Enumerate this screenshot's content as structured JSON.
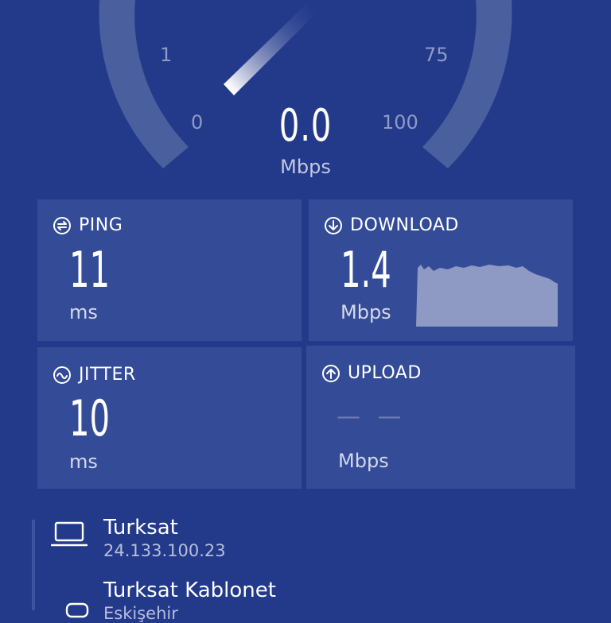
{
  "gauge": {
    "ticks": {
      "t0": "0",
      "t1": "1",
      "t75": "75",
      "t100": "100"
    },
    "value": "0.0",
    "unit": "Mbps"
  },
  "cards": {
    "ping": {
      "label": "PING",
      "value": "11",
      "unit": "ms",
      "icon": "ping-icon"
    },
    "download": {
      "label": "DOWNLOAD",
      "value": "1.4",
      "unit": "Mbps",
      "icon": "download-arrow-icon"
    },
    "jitter": {
      "label": "JITTER",
      "value": "10",
      "unit": "ms",
      "icon": "jitter-wave-icon"
    },
    "upload": {
      "label": "UPLOAD",
      "value": "— —",
      "unit": "Mbps",
      "icon": "upload-arrow-icon"
    }
  },
  "connection": {
    "provider": "Turksat",
    "ip": "24.133.100.23",
    "server_name": "Turksat Kablonet",
    "server_location": "Eskişehir"
  },
  "colors": {
    "background": "#233a8b",
    "card": "#344c97",
    "arc": "#4a5f9e",
    "graph_fill": "#8e99c4"
  }
}
